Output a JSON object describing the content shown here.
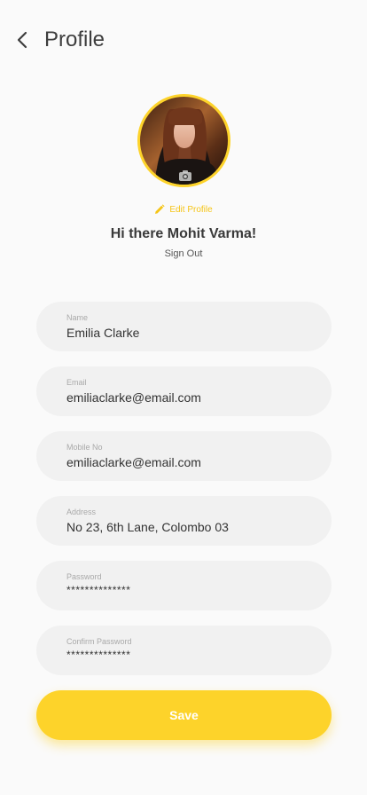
{
  "header": {
    "title": "Profile",
    "back_icon": "chevron-left-icon"
  },
  "profile": {
    "avatar_alt": "profile photo",
    "camera_icon": "camera-icon",
    "edit_label": "Edit Profile",
    "edit_icon": "pencil-icon",
    "greeting": "Hi there Mohit Varma!",
    "signout_label": "Sign Out"
  },
  "form": {
    "fields": [
      {
        "label": "Name",
        "value": "Emilia Clarke"
      },
      {
        "label": "Email",
        "value": "emiliaclarke@email.com"
      },
      {
        "label": "Mobile No",
        "value": "emiliaclarke@email.com"
      },
      {
        "label": "Address",
        "value": "No 23, 6th Lane, Colombo 03"
      },
      {
        "label": "Password",
        "value": "**************"
      },
      {
        "label": "Confirm Password",
        "value": "**************"
      }
    ],
    "save_label": "Save"
  },
  "colors": {
    "accent": "#fdd32a",
    "field_bg": "#f1f1f1",
    "background": "#fafafa"
  }
}
